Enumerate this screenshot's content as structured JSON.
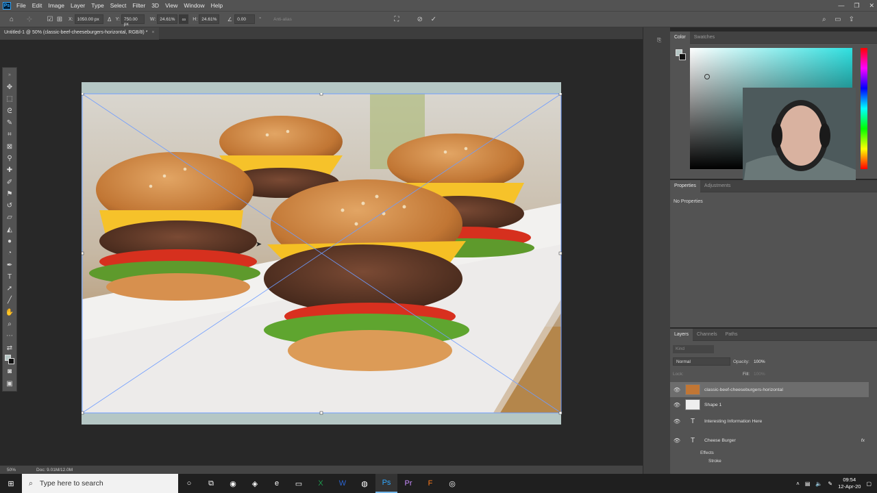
{
  "app": {
    "logo": "Ps"
  },
  "menu": [
    "File",
    "Edit",
    "Image",
    "Layer",
    "Type",
    "Select",
    "Filter",
    "3D",
    "View",
    "Window",
    "Help"
  ],
  "options": {
    "x_label": "X:",
    "x_value": "1050.00 px",
    "y_label": "Y:",
    "y_value": "750.00 px",
    "w_label": "W:",
    "w_value": "24.61%",
    "h_label": "H:",
    "h_value": "24.61%",
    "angle_value": "0.00",
    "antialias": "Anti-alias"
  },
  "document_tab": {
    "title": "Untitled-1 @ 50% (classic-beef-cheeseburgers-horizontal, RGB/8) *",
    "close": "×"
  },
  "color_panel": {
    "tabs": [
      "Color",
      "Swatches"
    ]
  },
  "properties_panel": {
    "tabs": [
      "Properties",
      "Adjustments"
    ],
    "message": "No Properties"
  },
  "layers_panel": {
    "tabs": [
      "Layers",
      "Channels",
      "Paths"
    ],
    "filter_placeholder": "Kind",
    "blend_mode": "Normal",
    "opacity_label": "Opacity:",
    "opacity_value": "100%",
    "lock_label": "Lock:",
    "fill_label": "Fill:",
    "fill_value": "100%",
    "layers": [
      {
        "name": "classic-beef-cheeseburgers-horizontal",
        "kind": "image",
        "selected": true
      },
      {
        "name": "Shape 1",
        "kind": "shape",
        "selected": false
      },
      {
        "name": "Interesting  Information Here",
        "kind": "text",
        "selected": false
      },
      {
        "name": "Cheese Burger",
        "kind": "text",
        "selected": false,
        "fx": "fx"
      }
    ],
    "effects_label": "Effects",
    "stroke_label": "Stroke"
  },
  "status": {
    "zoom": "50%",
    "doc": "Doc: 9.01M/12.0M"
  },
  "taskbar": {
    "search_placeholder": "Type here to search",
    "time": "09:54",
    "date": "12-Apr-20"
  },
  "colors": {
    "accent": "#31a8ff",
    "artboard": "#b5c7c5",
    "selection": "#6d6d6d"
  }
}
